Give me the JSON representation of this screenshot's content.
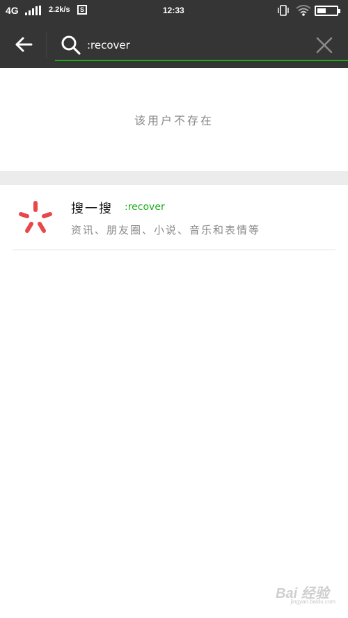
{
  "status_bar": {
    "network": "4G",
    "speed": "2.2k/s",
    "sim_badge": "S",
    "time": "12:33"
  },
  "search": {
    "query": ":recover"
  },
  "results": {
    "empty_message": "该用户不存在",
    "sousou": {
      "title": "搜一搜",
      "keyword": ":recover",
      "description": "资讯、朋友圈、小说、音乐和表情等"
    }
  },
  "colors": {
    "header_bg": "#353535",
    "accent_green": "#1aad19",
    "sousou_red": "#e8474c",
    "gap_gray": "#ececec"
  },
  "watermark": {
    "logo": "Bai 经验",
    "url": "jingyan.baidu.com"
  }
}
